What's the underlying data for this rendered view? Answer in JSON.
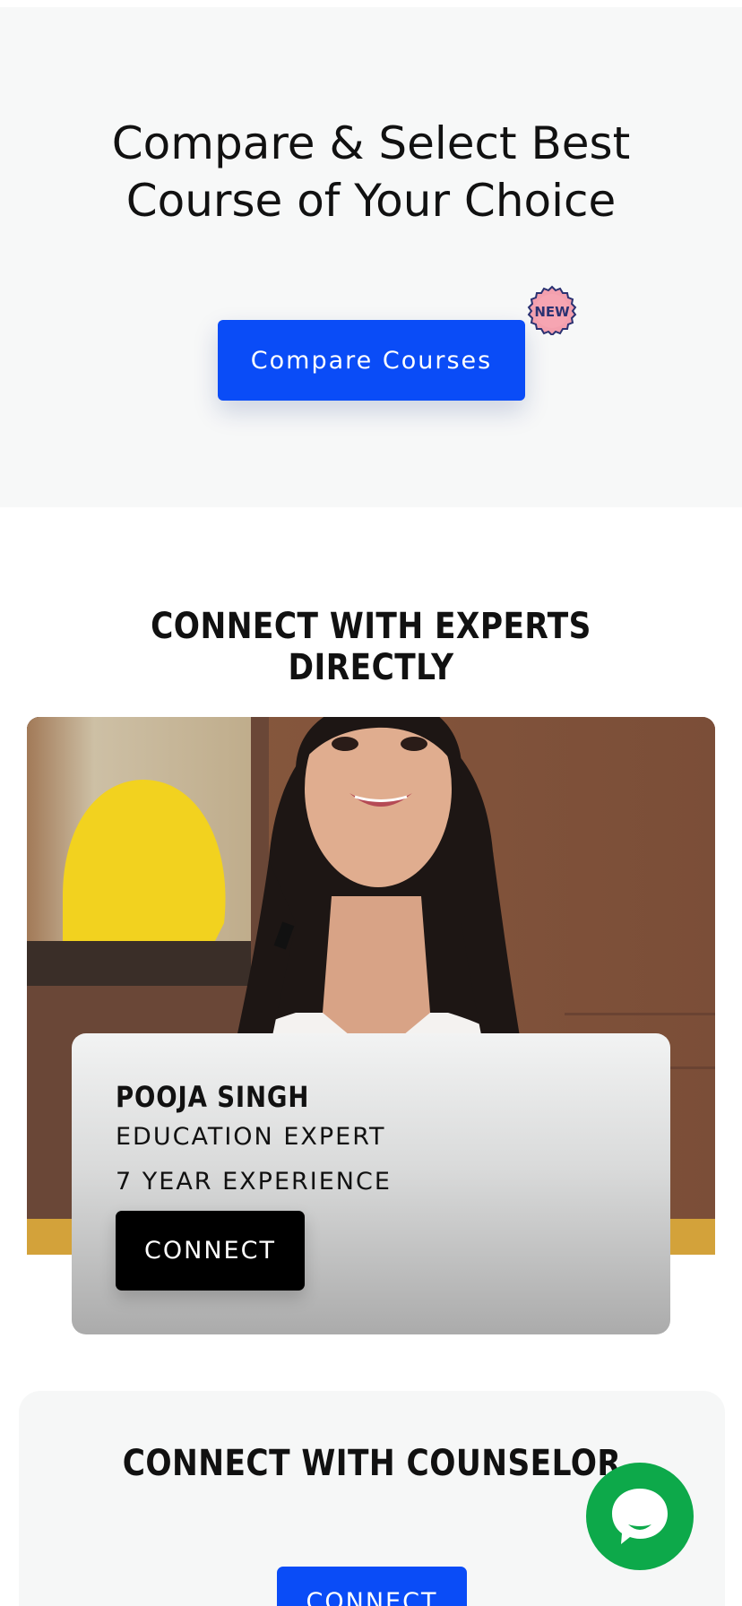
{
  "compare": {
    "title_line1": "Compare & Select Best",
    "title_line2": "Course of Your Choice",
    "button_label": "Compare Courses",
    "badge_label": "NEW"
  },
  "experts": {
    "heading": "CONNECT WITH EXPERTS DIRECTLY",
    "card": {
      "name": "POOJA SINGH",
      "role": "EDUCATION EXPERT",
      "experience": "7 YEAR EXPERIENCE",
      "button_label": "CONNECT"
    }
  },
  "counselor": {
    "heading": "CONNECT WITH COUNSELOR",
    "button_label": "CONNECT"
  },
  "chat": {
    "icon": "chat-bubble-icon",
    "color": "#0da94a"
  },
  "colors": {
    "primary_blue": "#0a4cf7",
    "dark": "#000000",
    "section_bg": "#f7f8f8"
  }
}
